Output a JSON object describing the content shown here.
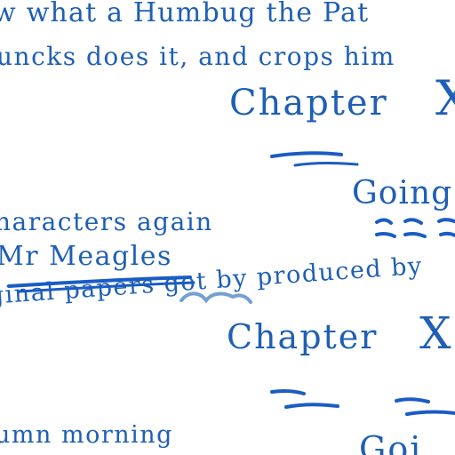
{
  "lines": {
    "line1": "w what a Humbug the Pat",
    "line2": "uncks does it, and crops him",
    "chapter_heading_1": "Chapter",
    "chapter_numeral_1": "X",
    "going_heading_1": "Going",
    "characters_line": "haracters again",
    "meagles_line": "Mr Meagles",
    "original_papers_line": "ginal papers got by produced by",
    "chapter_heading_2": "Chapter",
    "chapter_numeral_2": "X",
    "autumn_line": "umn morning",
    "going_heading_2": "Goi"
  },
  "colors": {
    "print_ink": "#1f5fb4",
    "pen_ink": "#1a5cc4",
    "pencil_strike": "#5a8fc9"
  }
}
